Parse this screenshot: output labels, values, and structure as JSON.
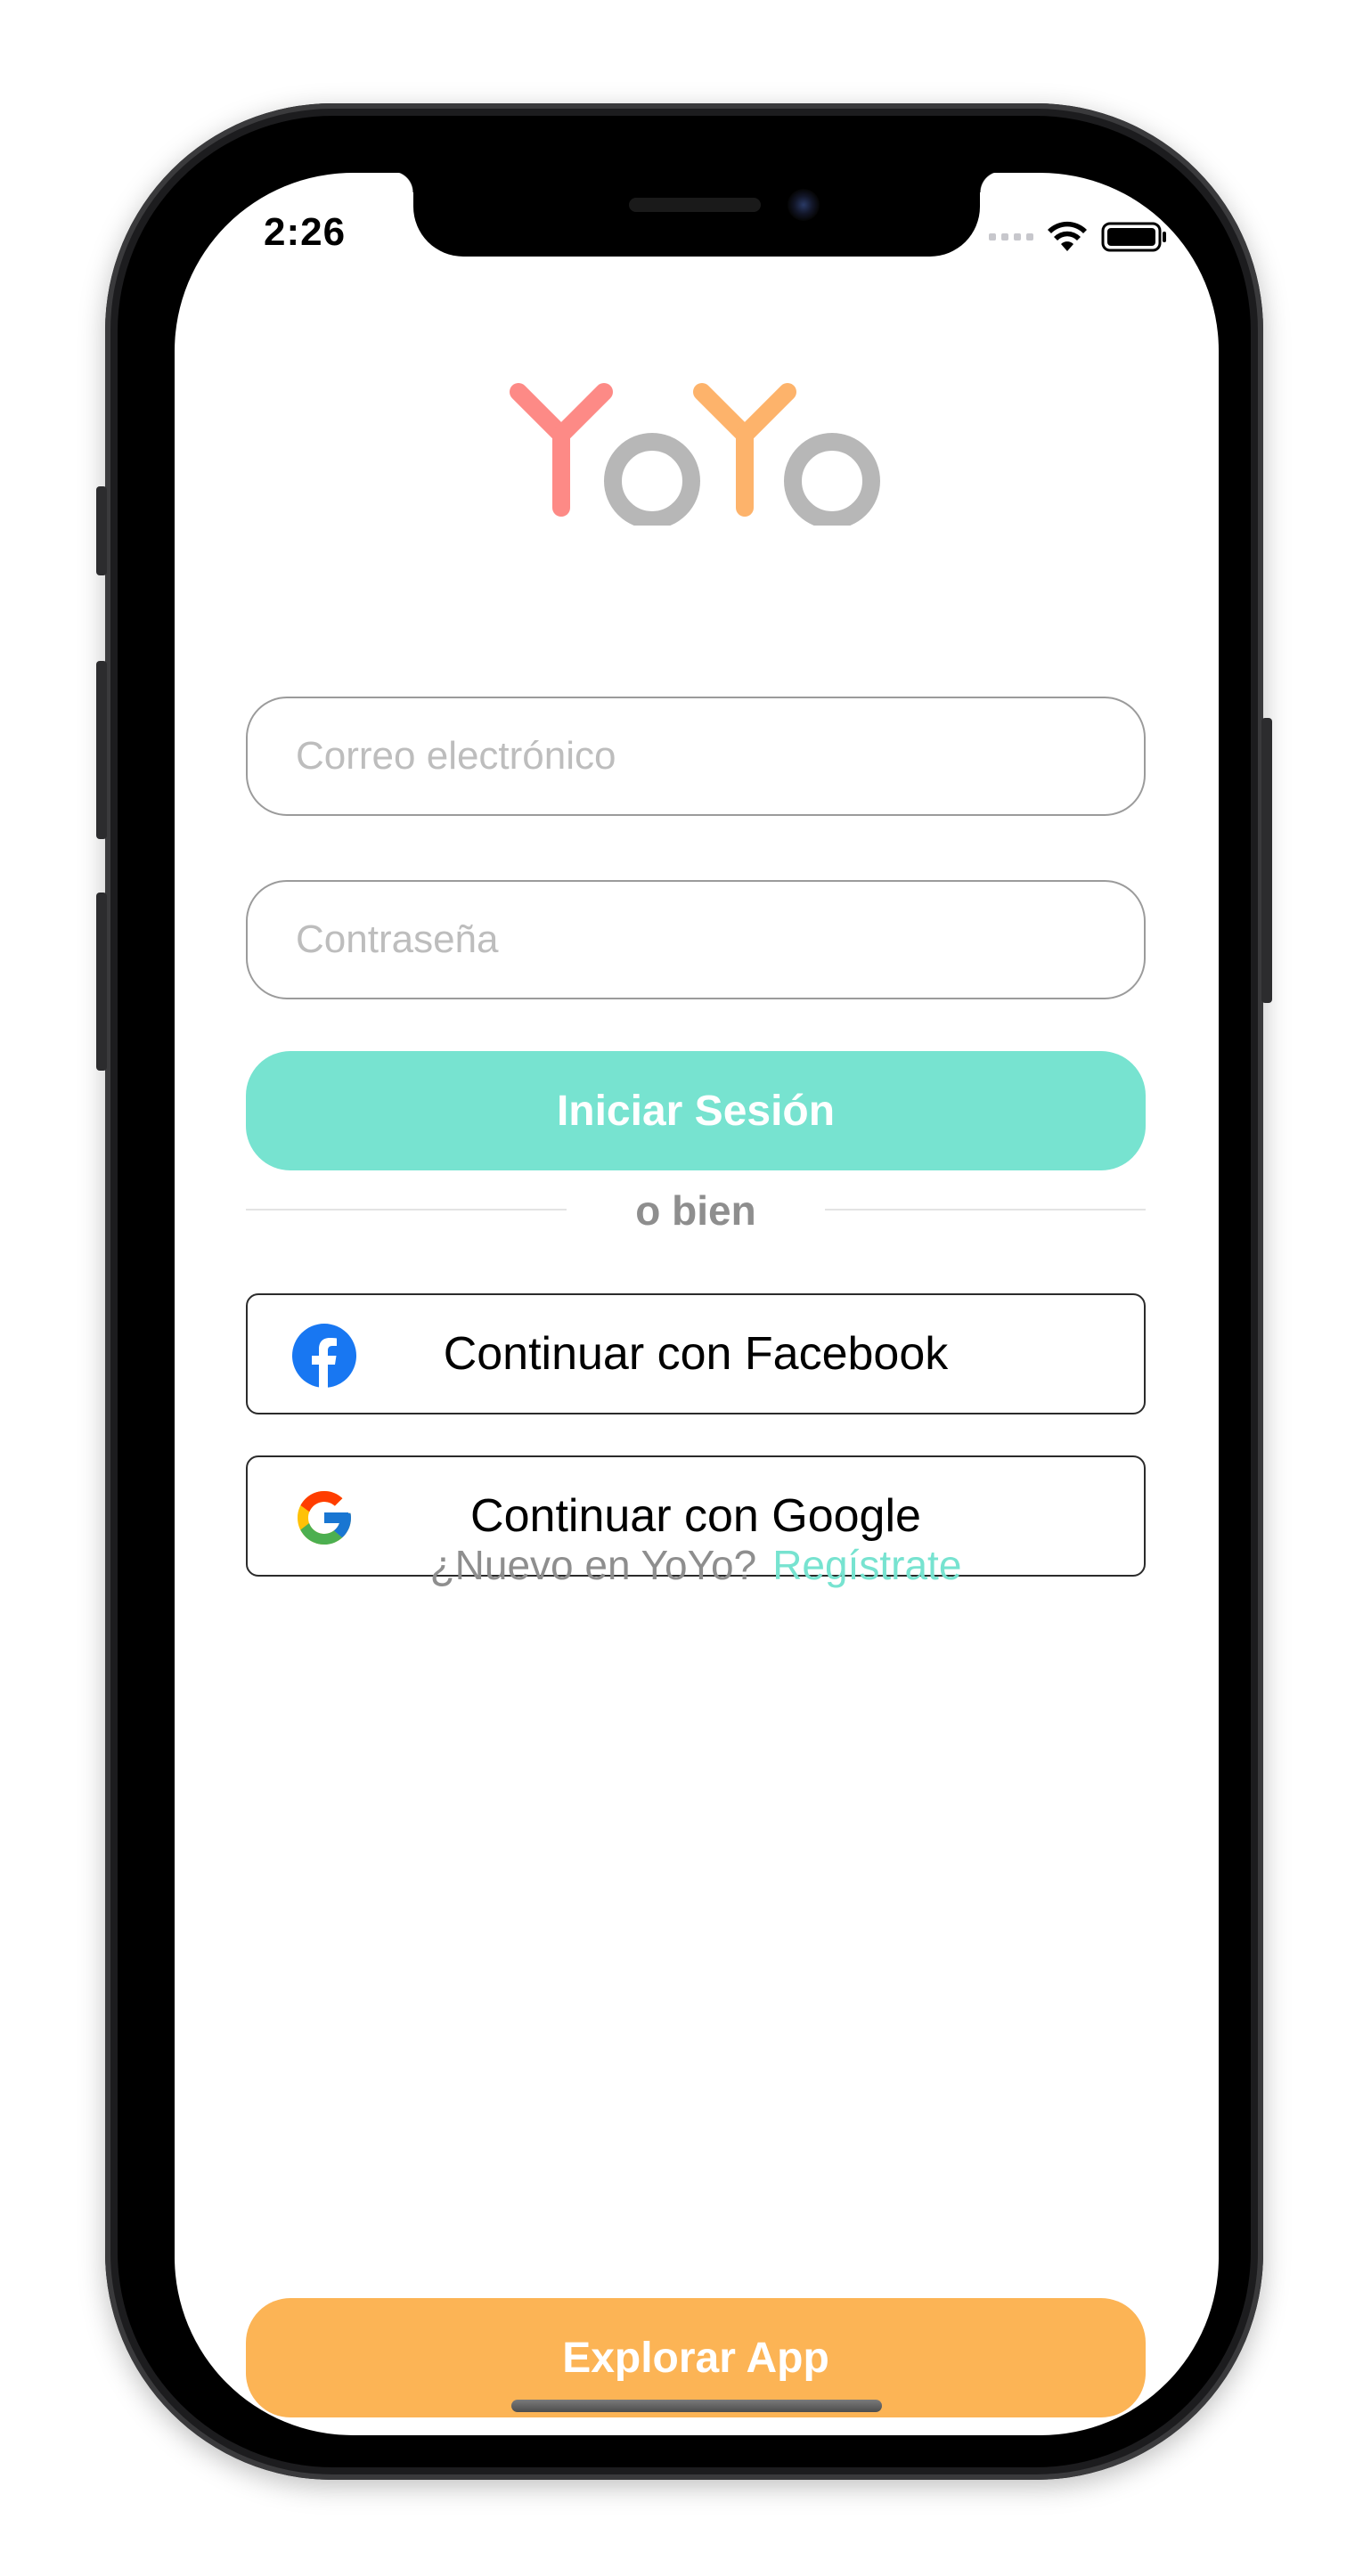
{
  "status_bar": {
    "time": "2:26"
  },
  "brand": {
    "logo_text": "YoYo",
    "colors": {
      "y1": "#fd8a86",
      "y2": "#fdb36b",
      "o": "#b7b7b7"
    }
  },
  "login": {
    "email_placeholder": "Correo electrónico",
    "password_placeholder": "Contraseña",
    "submit_label": "Iniciar Sesión",
    "submit_color": "#77e3d0",
    "divider_text": "o bien"
  },
  "social": {
    "facebook_label": "Continuar con Facebook",
    "facebook_icon": "facebook-icon",
    "google_label": "Continuar con Google",
    "google_icon": "google-icon"
  },
  "signup": {
    "question": "¿Nuevo en YoYo?",
    "link_label": "Regístrate",
    "link_color": "#77e3d0"
  },
  "explore": {
    "label": "Explorar App",
    "color": "#fcb455"
  }
}
